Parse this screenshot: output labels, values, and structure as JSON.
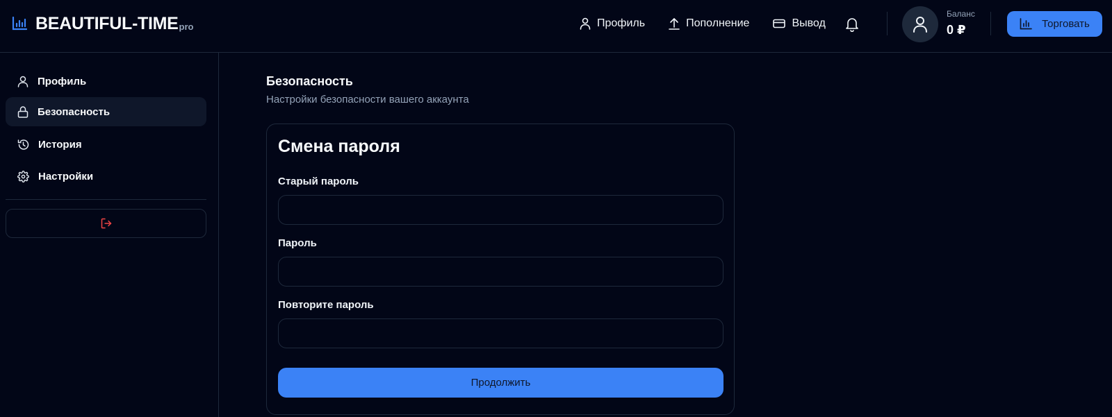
{
  "header": {
    "logo_text": "BEAUTIFUL-TIME",
    "logo_suffix": "pro",
    "logo_icon": "chart-bar-icon",
    "nav": [
      {
        "label": "Профиль",
        "icon": "user-icon"
      },
      {
        "label": "Пополнение",
        "icon": "upload-icon"
      },
      {
        "label": "Вывод",
        "icon": "credit-card-icon"
      }
    ],
    "notifications_icon": "bell-icon",
    "balance_label": "Баланс",
    "balance_value": "0 ₽",
    "trade_label": "Торговать"
  },
  "sidebar": {
    "items": [
      {
        "label": "Профиль",
        "icon": "user-icon",
        "active": false
      },
      {
        "label": "Безопасность",
        "icon": "lock-icon",
        "active": true
      },
      {
        "label": "История",
        "icon": "history-icon",
        "active": false
      },
      {
        "label": "Настройки",
        "icon": "gear-icon",
        "active": false
      }
    ],
    "logout_icon": "logout-icon"
  },
  "main": {
    "title": "Безопасность",
    "subtitle": "Настройки безопасности вашего аккаунта",
    "card": {
      "title": "Смена пароля",
      "fields": [
        {
          "label": "Старый пароль",
          "value": ""
        },
        {
          "label": "Пароль",
          "value": ""
        },
        {
          "label": "Повторите пароль",
          "value": ""
        }
      ],
      "submit_label": "Продолжить"
    }
  },
  "colors": {
    "background": "#020617",
    "accent": "#3b82f6",
    "border": "#1e293b",
    "danger": "#ef4444",
    "muted_text": "#94a3b8"
  }
}
